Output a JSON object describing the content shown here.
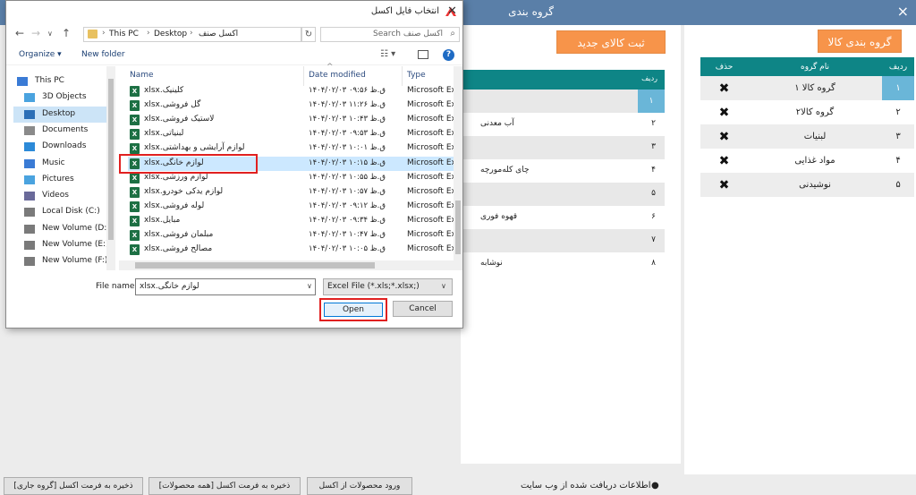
{
  "app": {
    "title": "گروه بندی",
    "close_icon": "×",
    "group_button": "گروه بندی کالا",
    "new_goods_button": "ثبت کالای جدید",
    "group_table": {
      "headers": [
        "ردیف",
        "نام گروه",
        "حذف"
      ],
      "rows": [
        {
          "idx": "۱",
          "name": "گروه کالا ۱"
        },
        {
          "idx": "۲",
          "name": "گروه کالا۲"
        },
        {
          "idx": "۳",
          "name": "لبنیات"
        },
        {
          "idx": "۴",
          "name": "مواد غذایی"
        },
        {
          "idx": "۵",
          "name": "نوشیدنی"
        }
      ],
      "delete_glyph": "✖"
    },
    "goods_header": "ردیف",
    "goods_rows": [
      {
        "idx": "۱",
        "name": ""
      },
      {
        "idx": "۲",
        "name": "آب معدنی"
      },
      {
        "idx": "۳",
        "name": ""
      },
      {
        "idx": "۴",
        "name": "چای کله‌مورچه"
      },
      {
        "idx": "۵",
        "name": ""
      },
      {
        "idx": "۶",
        "name": "قهوه فوری"
      },
      {
        "idx": "۷",
        "name": ""
      },
      {
        "idx": "۸",
        "name": "نوشابه"
      }
    ],
    "bottom": {
      "btn_save_current": "ذخیره به فرمت اکسل [گروه جاری]",
      "btn_save_all": "ذخیره به فرمت اکسل [همه محصولات]",
      "btn_import": "ورود محصولات از اکسل",
      "info": "اطلاعات دریافت شده از وب سایت",
      "bullet": "●"
    }
  },
  "dialog": {
    "title": "انتخاب فایل اکسل",
    "close_icon": "✕",
    "breadcrumb": [
      "This PC",
      "Desktop",
      "اکسل صنف"
    ],
    "search_placeholder": "Search اکسل صنف",
    "toolbar": {
      "organize": "Organize ▾",
      "new_folder": "New folder"
    },
    "nav_items": [
      {
        "label": "This PC",
        "color": "#3a7bd5"
      },
      {
        "label": "3D Objects",
        "color": "#4aa3df"
      },
      {
        "label": "Desktop",
        "color": "#2c6fb7"
      },
      {
        "label": "Documents",
        "color": "#8a8a8a"
      },
      {
        "label": "Downloads",
        "color": "#2c8ad8"
      },
      {
        "label": "Music",
        "color": "#3a7bd5"
      },
      {
        "label": "Pictures",
        "color": "#4aa3df"
      },
      {
        "label": "Videos",
        "color": "#6a6a9a"
      },
      {
        "label": "Local Disk (C:)",
        "color": "#7a7a7a"
      },
      {
        "label": "New Volume (D:)",
        "color": "#7a7a7a"
      },
      {
        "label": "New Volume (E:)",
        "color": "#7a7a7a"
      },
      {
        "label": "New Volume (F:)",
        "color": "#7a7a7a"
      }
    ],
    "columns": {
      "name": "Name",
      "date": "Date modified",
      "type": "Type"
    },
    "files": [
      {
        "name": "کلینیک.xlsx",
        "date": "۱۴۰۴/۰۲/۰۳ ق.ظ ۰۹:۵۶",
        "type": "Microsoft Excel"
      },
      {
        "name": "گل فروشی.xlsx",
        "date": "۱۴۰۴/۰۲/۰۳ ق.ظ ۱۱:۲۶",
        "type": "Microsoft Excel"
      },
      {
        "name": "لاستیک فروشی.xlsx",
        "date": "۱۴۰۴/۰۲/۰۳ ق.ظ ۱۰:۴۳",
        "type": "Microsoft Excel"
      },
      {
        "name": "لبنیاتی.xlsx",
        "date": "۱۴۰۴/۰۲/۰۳ ق.ظ ۰۹:۵۳",
        "type": "Microsoft Excel"
      },
      {
        "name": "لوازم آرایشی و بهداشتی.xlsx",
        "date": "۱۴۰۴/۰۲/۰۳ ق.ظ ۱۰:۰۱",
        "type": "Microsoft Excel"
      },
      {
        "name": "لوازم خانگی.xlsx",
        "date": "۱۴۰۴/۰۲/۰۳ ق.ظ ۱۰:۱۵",
        "type": "Microsoft Excel",
        "selected": true
      },
      {
        "name": "لوازم ورزشی.xlsx",
        "date": "۱۴۰۴/۰۲/۰۳ ق.ظ ۱۰:۵۵",
        "type": "Microsoft Excel"
      },
      {
        "name": "لوازم یدکی خودرو.xlsx",
        "date": "۱۴۰۴/۰۲/۰۳ ق.ظ ۱۰:۵۷",
        "type": "Microsoft Excel"
      },
      {
        "name": "لوله فروشی.xlsx",
        "date": "۱۴۰۴/۰۲/۰۳ ق.ظ ۰۹:۱۲",
        "type": "Microsoft Excel"
      },
      {
        "name": "مبایل.xlsx",
        "date": "۱۴۰۴/۰۲/۰۳ ق.ظ ۰۹:۳۴",
        "type": "Microsoft Excel"
      },
      {
        "name": "مبلمان فروشی.xlsx",
        "date": "۱۴۰۴/۰۲/۰۳ ق.ظ ۱۰:۴۷",
        "type": "Microsoft Excel"
      },
      {
        "name": "مصالح فروشی.xlsx",
        "date": "۱۴۰۴/۰۲/۰۳ ق.ظ ۱۰:۰۵",
        "type": "Microsoft Excel"
      }
    ],
    "file_name_label": "File name:",
    "file_name_value": "لوازم خانگی.xlsx",
    "file_type_value": "Excel File (*.xls;*.xlsx;)",
    "open_button": "Open",
    "cancel_button": "Cancel",
    "highlight_color": "#e02020"
  }
}
